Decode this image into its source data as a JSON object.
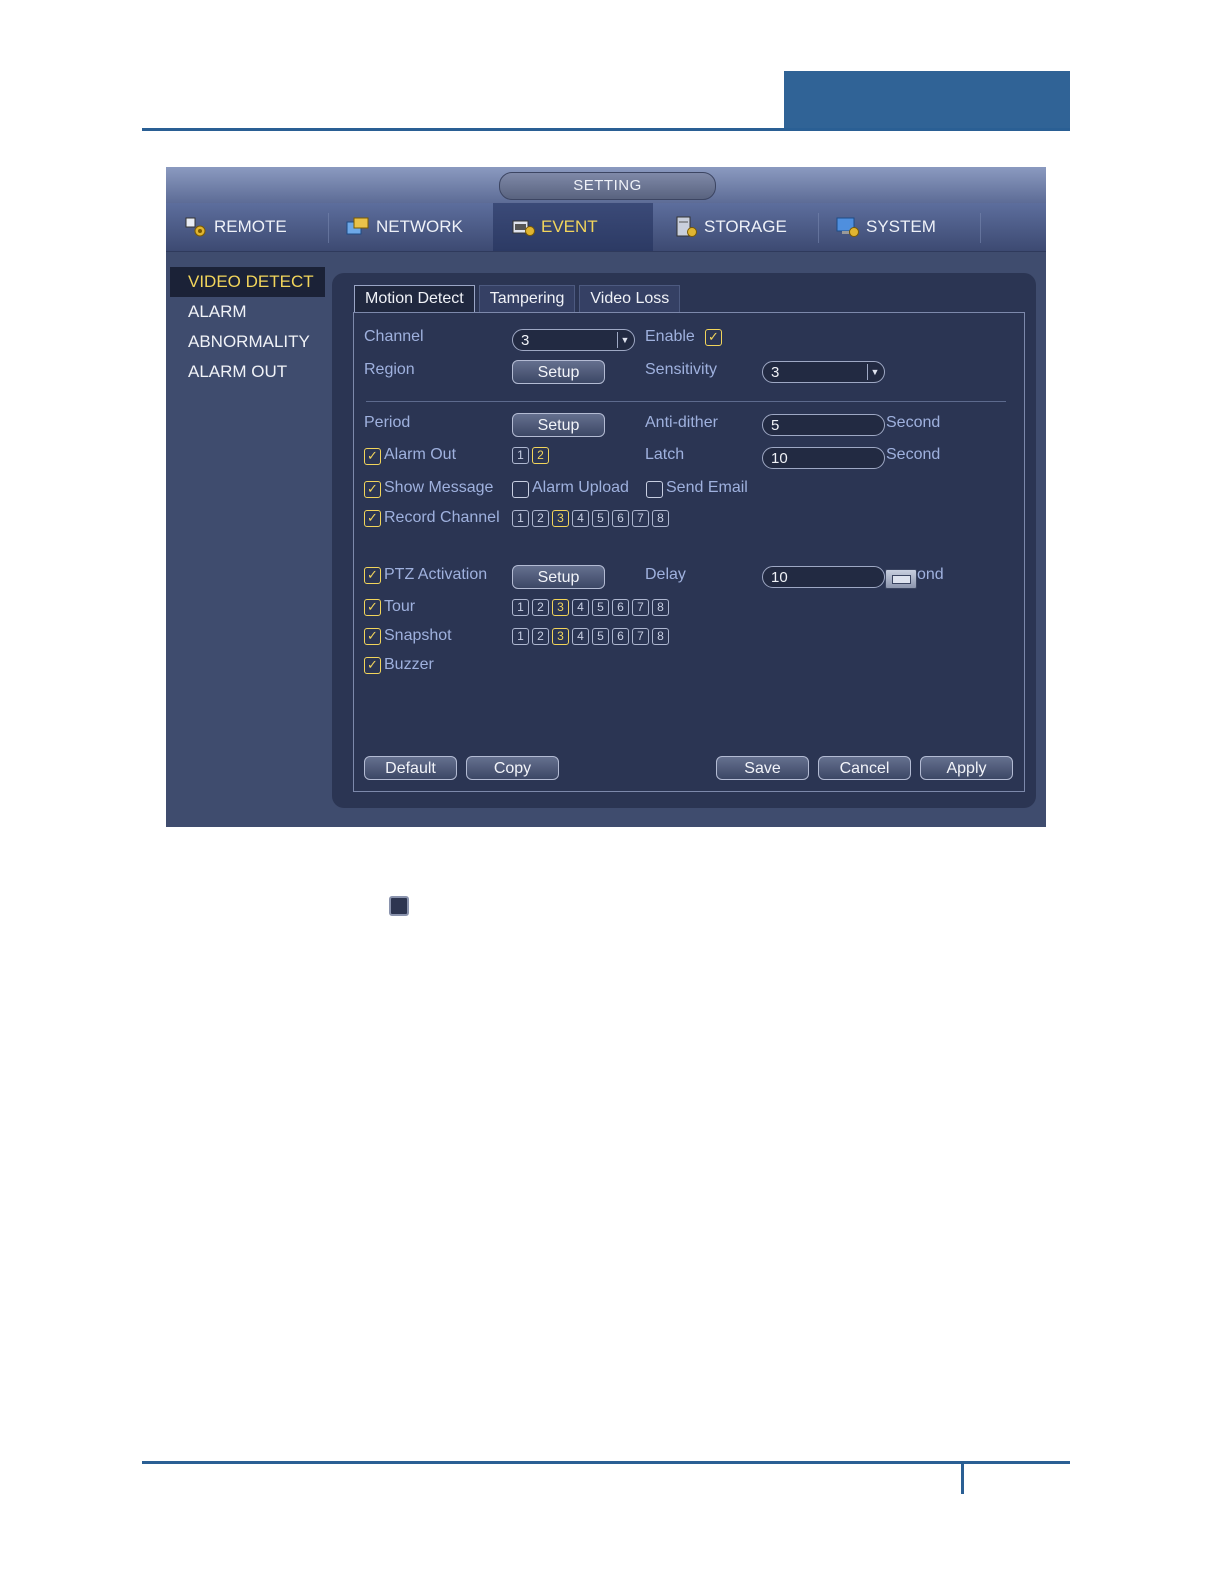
{
  "window": {
    "title": "SETTING"
  },
  "topnav": [
    {
      "label": "REMOTE",
      "icon": "remote-icon"
    },
    {
      "label": "NETWORK",
      "icon": "network-icon"
    },
    {
      "label": "EVENT",
      "icon": "event-icon",
      "active": true
    },
    {
      "label": "STORAGE",
      "icon": "storage-icon"
    },
    {
      "label": "SYSTEM",
      "icon": "system-icon"
    }
  ],
  "leftnav": [
    {
      "label": "VIDEO DETECT",
      "active": true
    },
    {
      "label": "ALARM"
    },
    {
      "label": "ABNORMALITY"
    },
    {
      "label": "ALARM OUT"
    }
  ],
  "subtabs": [
    {
      "label": "Motion Detect",
      "active": true
    },
    {
      "label": "Tampering"
    },
    {
      "label": "Video Loss"
    }
  ],
  "form": {
    "channel_label": "Channel",
    "channel_value": "3",
    "enable_label": "Enable",
    "region_label": "Region",
    "setup_label": "Setup",
    "sensitivity_label": "Sensitivity",
    "sensitivity_value": "3",
    "period_label": "Period",
    "antidither_label": "Anti-dither",
    "antidither_value": "5",
    "second_label": "Second",
    "alarm_out_label": "Alarm Out",
    "latch_label": "Latch",
    "latch_value": "10",
    "show_message_label": "Show Message",
    "alarm_upload_label": "Alarm Upload",
    "send_email_label": "Send Email",
    "record_channel_label": "Record Channel",
    "ptz_label": "PTZ Activation",
    "delay_label": "Delay",
    "delay_value": "10",
    "delay_unit_partial": "ond",
    "tour_label": "Tour",
    "snapshot_label": "Snapshot",
    "buzzer_label": "Buzzer",
    "alarm_out_channels": [
      "1",
      "2"
    ],
    "channels": [
      "1",
      "2",
      "3",
      "4",
      "5",
      "6",
      "7",
      "8"
    ]
  },
  "buttons": {
    "default": "Default",
    "copy": "Copy",
    "save": "Save",
    "cancel": "Cancel",
    "apply": "Apply"
  },
  "colors": {
    "accent": "#f2d55b",
    "brand": "#306396"
  }
}
